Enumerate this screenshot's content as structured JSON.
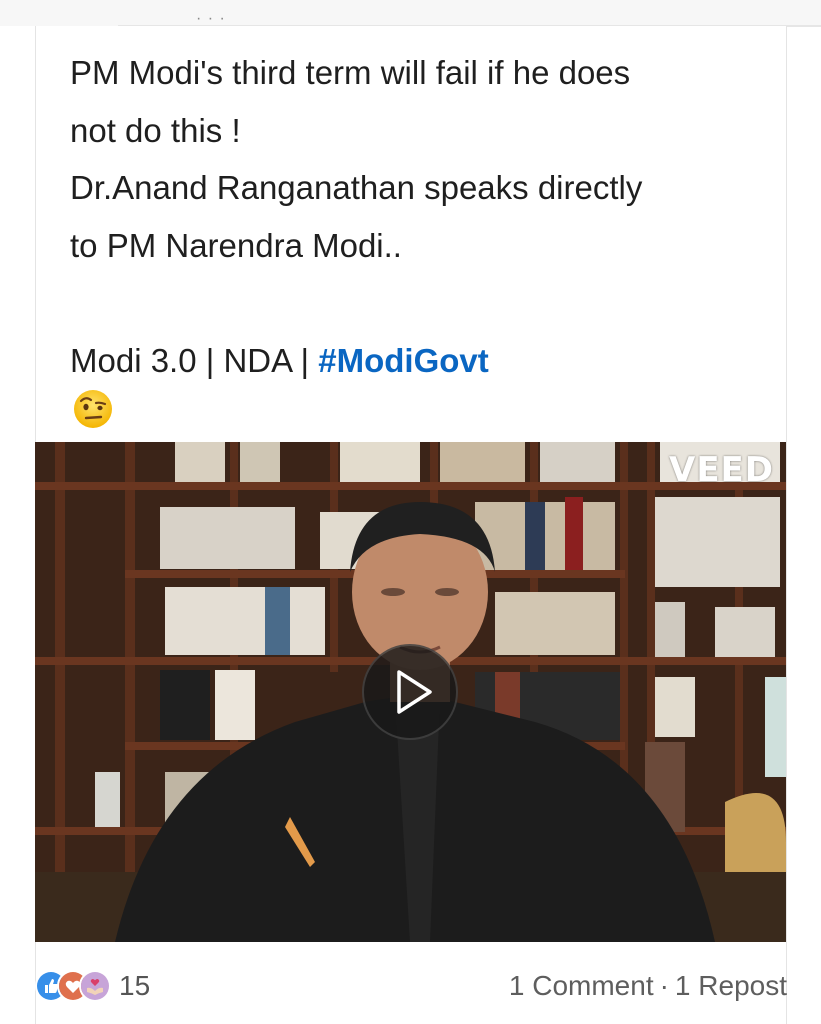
{
  "post": {
    "lines": [
      "PM Modi's third term will fail if he does",
      "not do this !",
      "Dr.Anand Ranganathan speaks directly",
      "to PM Narendra Modi.."
    ],
    "tags_prefix": "Modi 3.0 | NDA | ",
    "hashtag": "#ModiGovt",
    "emoji_icon": "face-with-raised-eyebrow-emoji"
  },
  "video": {
    "watermark": "VEED",
    "play_icon": "play-icon"
  },
  "footer": {
    "reaction_icons": [
      "like-icon",
      "love-icon",
      "support-icon"
    ],
    "reaction_count": "15",
    "comments": "1 Comment",
    "separator": "·",
    "reposts": "1 Repost"
  },
  "colors": {
    "hashtag": "#0a66c2",
    "text": "#1f1f1f",
    "meta": "#5e5e5e",
    "like": "#378fe9",
    "love": "#df704d",
    "support": "#c7a4d8"
  }
}
